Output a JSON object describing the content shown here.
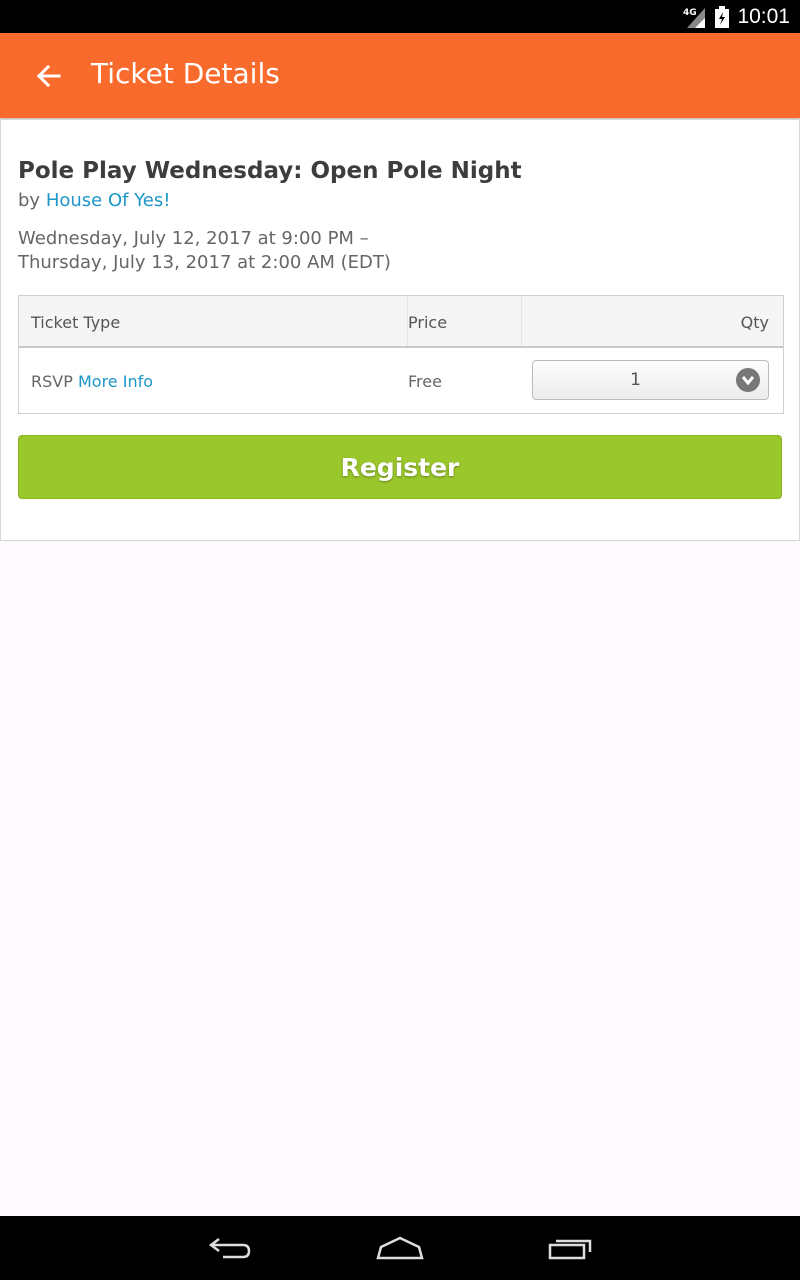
{
  "status_bar": {
    "network": "4G",
    "time": "10:01"
  },
  "app_bar": {
    "title": "Ticket Details",
    "back_icon": "arrow-left-icon"
  },
  "event": {
    "title": "Pole Play Wednesday: Open Pole Night",
    "by_prefix": "by",
    "organizer": "House Of Yes!",
    "date_start": "Wednesday, July 12, 2017 at 9:00 PM –",
    "date_end": "Thursday, July 13, 2017 at 2:00 AM (EDT)"
  },
  "ticket_table": {
    "headers": {
      "type": "Ticket Type",
      "price": "Price",
      "qty": "Qty"
    },
    "rows": [
      {
        "type": "RSVP",
        "more_info": "More Info",
        "price": "Free",
        "qty": "1"
      }
    ]
  },
  "register_label": "Register",
  "nav": {
    "back_icon": "back-icon",
    "home_icon": "home-icon",
    "recents_icon": "recents-icon"
  },
  "colors": {
    "accent": "#f96b2c",
    "link": "#1d96c8",
    "register": "#9ac72b"
  }
}
